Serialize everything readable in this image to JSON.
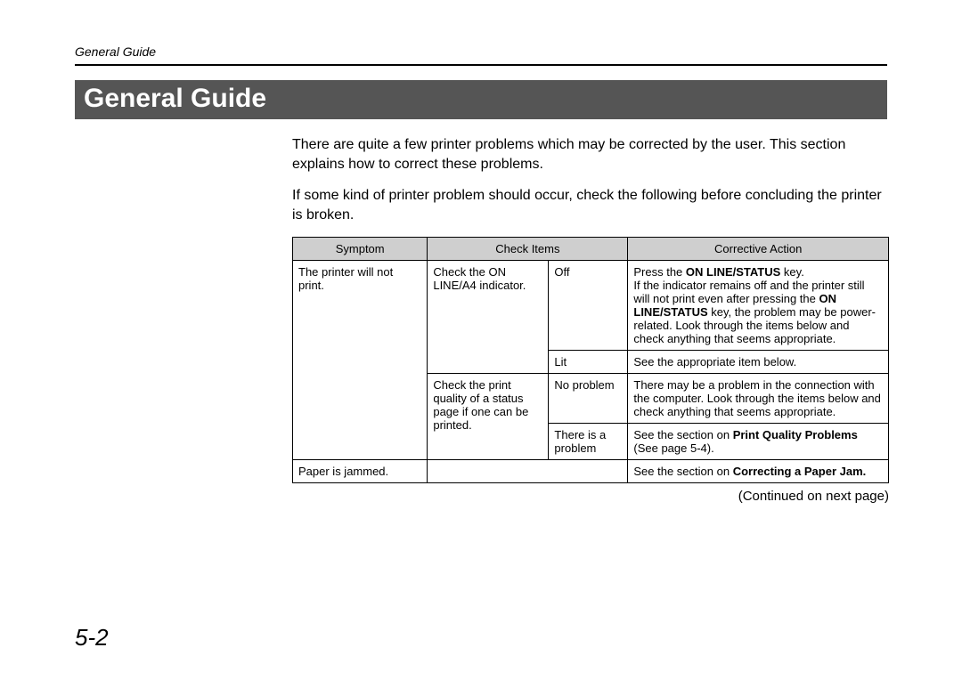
{
  "running_head": "General Guide",
  "title": "General Guide",
  "para1": "There are quite a few printer problems which may be corrected by the user.  This section explains how to correct these problems.",
  "para2": "If some kind of printer problem should occur, check the following before concluding the printer is broken.",
  "headers": {
    "symptom": "Symptom",
    "check": "Check Items",
    "action": "Corrective Action"
  },
  "rows": {
    "r1": {
      "symptom": "The printer will not print.",
      "check": "Check the ON LINE/A4 indicator.",
      "state": "Off",
      "a_pre": "Press the ",
      "a_b1": "ON LINE/STATUS",
      "a_mid1": " key.",
      "a_br": "If the indicator remains off and the printer still will not print even after pressing the ",
      "a_b2": "ON LINE/STATUS",
      "a_mid2": " key, the problem may be power-related.  Look through the items below and check anything that seems appropriate."
    },
    "r2": {
      "state": "Lit",
      "action": "See the appropriate item below."
    },
    "r3": {
      "check": "Check the print quality of a status page if one can be printed.",
      "state": "No problem",
      "action": "There may be a problem in the connection with the computer. Look through the items below and check anything that seems appropriate."
    },
    "r4": {
      "state": "There is a problem",
      "a_pre": "See the section on ",
      "a_b": "Print Quality Problems",
      "a_post": " (See page 5-4)."
    },
    "r5": {
      "symptom": "Paper is jammed.",
      "a_pre": "See the section on ",
      "a_b": "Correcting a Paper Jam."
    }
  },
  "continued": "(Continued on next page)",
  "page_number": "5-2"
}
